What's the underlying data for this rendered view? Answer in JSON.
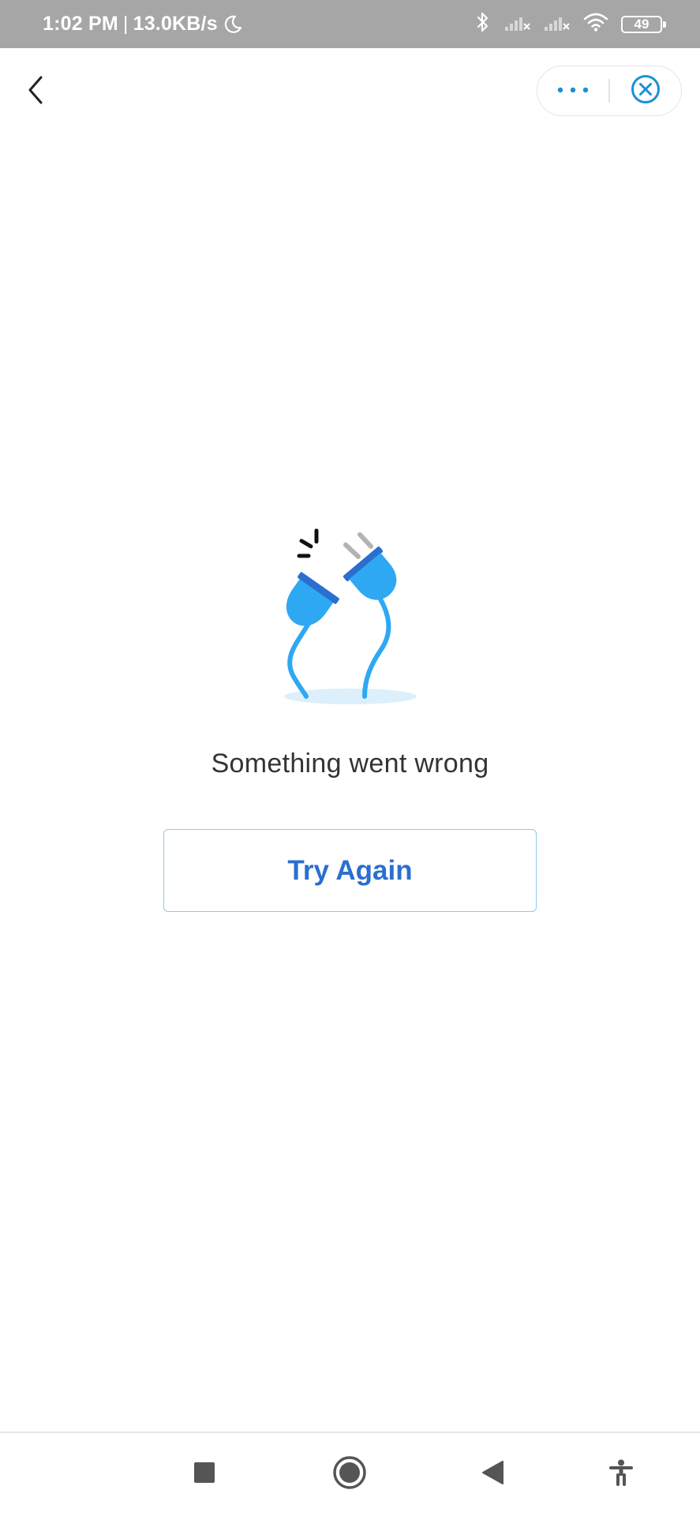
{
  "status_bar": {
    "time": "1:02 PM",
    "separator": "|",
    "network_speed": "13.0KB/s",
    "battery_level": "49",
    "icons": [
      "moon-icon",
      "bluetooth-icon",
      "signal-icon",
      "signal-icon",
      "wifi-icon",
      "battery-icon"
    ]
  },
  "header": {
    "back_icon": "chevron-left-icon",
    "more_icon": "more-dots-icon",
    "close_icon": "close-circle-icon"
  },
  "main": {
    "illustration": "unplugged-cable-icon",
    "message": "Something went wrong",
    "retry_label": "Try Again"
  },
  "nav_bar": {
    "icons": [
      "recent-apps-icon",
      "home-icon",
      "back-icon",
      "accessibility-icon"
    ]
  },
  "colors": {
    "status_bar": "#a6a6a6",
    "accent": "#1a90d6",
    "button_text": "#2a6fcf",
    "button_border": "#90c8ef",
    "plug_blue": "#2ea8f3",
    "plug_dark": "#2a6fcf"
  }
}
